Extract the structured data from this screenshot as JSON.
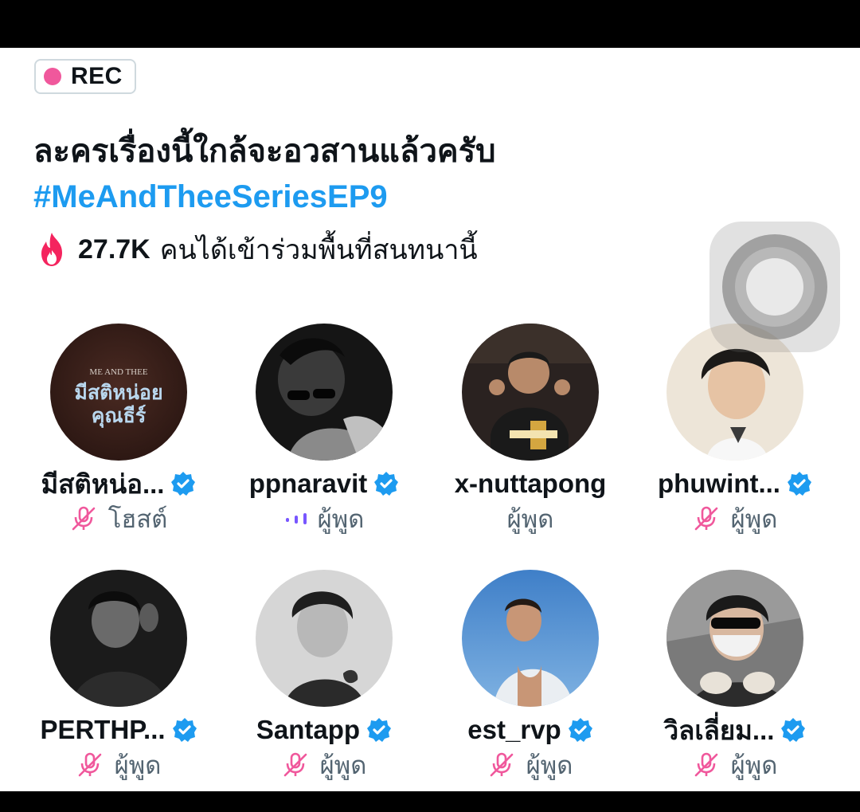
{
  "rec": {
    "label": "REC"
  },
  "space": {
    "title": "ละครเรื่องนี้ใกล้จะอวสานแล้วครับ",
    "hashtag": "#MeAndTheeSeriesEP9",
    "listeners_count": "27.7K",
    "listeners_text": "คนได้เข้าร่วมพื้นที่สนทนานี้"
  },
  "speakers": [
    {
      "name": "มีสติหน่อ...",
      "role": "โฮสต์",
      "verified": true,
      "status": "muted",
      "avatar_text_top": "ME AND THEE",
      "avatar_text_mid": "มีสติหน่อย",
      "avatar_text_bot": "คุณธีร์"
    },
    {
      "name": "ppnaravit",
      "role": "ผู้พูด",
      "verified": true,
      "status": "speaking"
    },
    {
      "name": "x-nuttapong",
      "role": "ผู้พูด",
      "verified": false,
      "status": "none"
    },
    {
      "name": "phuwint...",
      "role": "ผู้พูด",
      "verified": true,
      "status": "muted"
    },
    {
      "name": "PERTHP...",
      "role": "ผู้พูด",
      "verified": true,
      "status": "muted"
    },
    {
      "name": "Santapp",
      "role": "ผู้พูด",
      "verified": true,
      "status": "muted"
    },
    {
      "name": "est_rvp",
      "role": "ผู้พูด",
      "verified": true,
      "status": "muted"
    },
    {
      "name": "วิลเลี่ยม...",
      "role": "ผู้พูด",
      "verified": true,
      "status": "muted"
    }
  ],
  "colors": {
    "accent": "#1d9bf0",
    "mute": "#f0589c",
    "speaking": "#7856ff",
    "rec": "#f0589c"
  },
  "icons": {
    "rec": "record-dot-icon",
    "listeners": "flame-icon",
    "verified": "verified-badge-icon",
    "muted": "mic-off-icon",
    "speaking": "audio-bars-icon",
    "floating": "assistive-touch-icon"
  }
}
